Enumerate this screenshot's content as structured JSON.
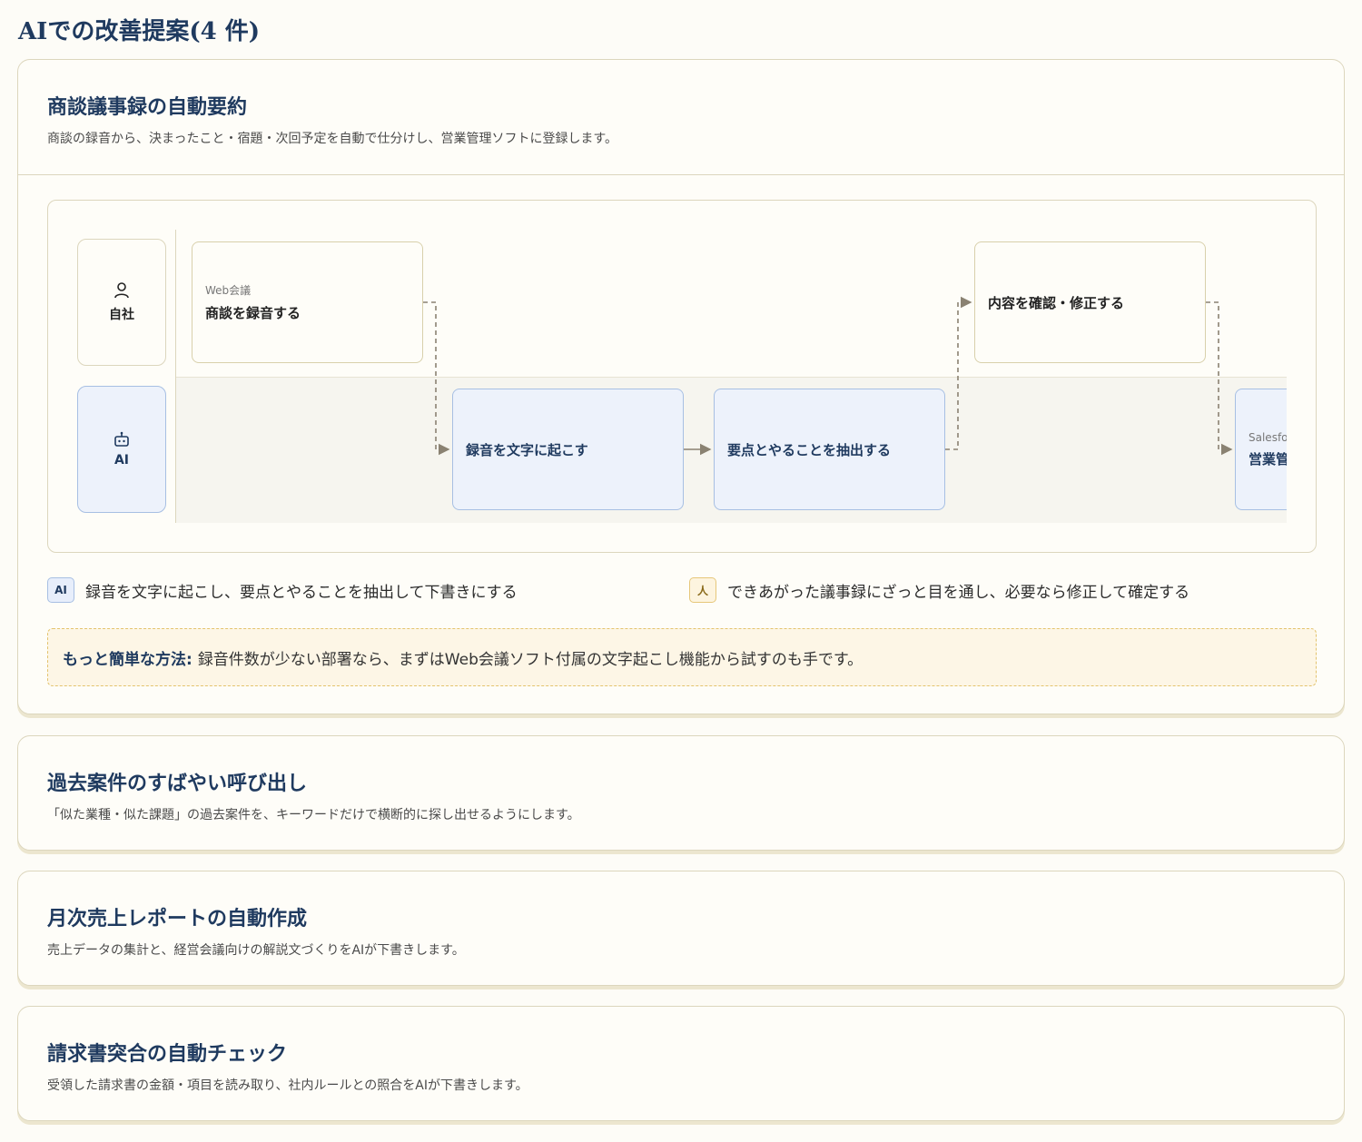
{
  "page_title": "AIでの改善提案(4 件)",
  "proposals": [
    {
      "title": "商談議事録の自動要約",
      "description": "商談の録音から、決まったこと・宿題・次回予定を自動で仕分けし、営業管理ソフトに登録します。",
      "lanes": {
        "self": "自社",
        "ai": "AI"
      },
      "steps": [
        {
          "tool": "Web会議",
          "label": "商談を録音する"
        },
        {
          "tool": "",
          "label": "録音を文字に起こす"
        },
        {
          "tool": "",
          "label": "要点とやることを抽出する"
        },
        {
          "tool": "",
          "label": "内容を確認・修正する"
        },
        {
          "tool": "Salesfo",
          "label": "営業管"
        }
      ],
      "roles": {
        "ai_badge": "AI",
        "ai_text": "録音を文字に起こし、要点とやることを抽出して下書きにする",
        "human_badge": "人",
        "human_text": "できあがった議事録にざっと目を通し、必要なら修正して確定する"
      },
      "tip": {
        "label": "もっと簡単な方法:",
        "text": "録音件数が少ない部署なら、まずはWeb会議ソフト付属の文字起こし機能から試すのも手です。"
      }
    },
    {
      "title": "過去案件のすばやい呼び出し",
      "description": "「似た業種・似た課題」の過去案件を、キーワードだけで横断的に探し出せるようにします。"
    },
    {
      "title": "月次売上レポートの自動作成",
      "description": "売上データの集計と、経営会議向けの解説文づくりをAIが下書きします。"
    },
    {
      "title": "請求書突合の自動チェック",
      "description": "受領した請求書の金額・項目を読み取り、社内ルールとの照合をAIが下書きします。"
    }
  ],
  "colors": {
    "title": "#1f3a5f",
    "ai_node_bg": "#edf2fb",
    "ai_node_border": "#a7bfe3",
    "human_badge_border": "#e6c77a",
    "tip_bg": "#fdf6e6"
  }
}
